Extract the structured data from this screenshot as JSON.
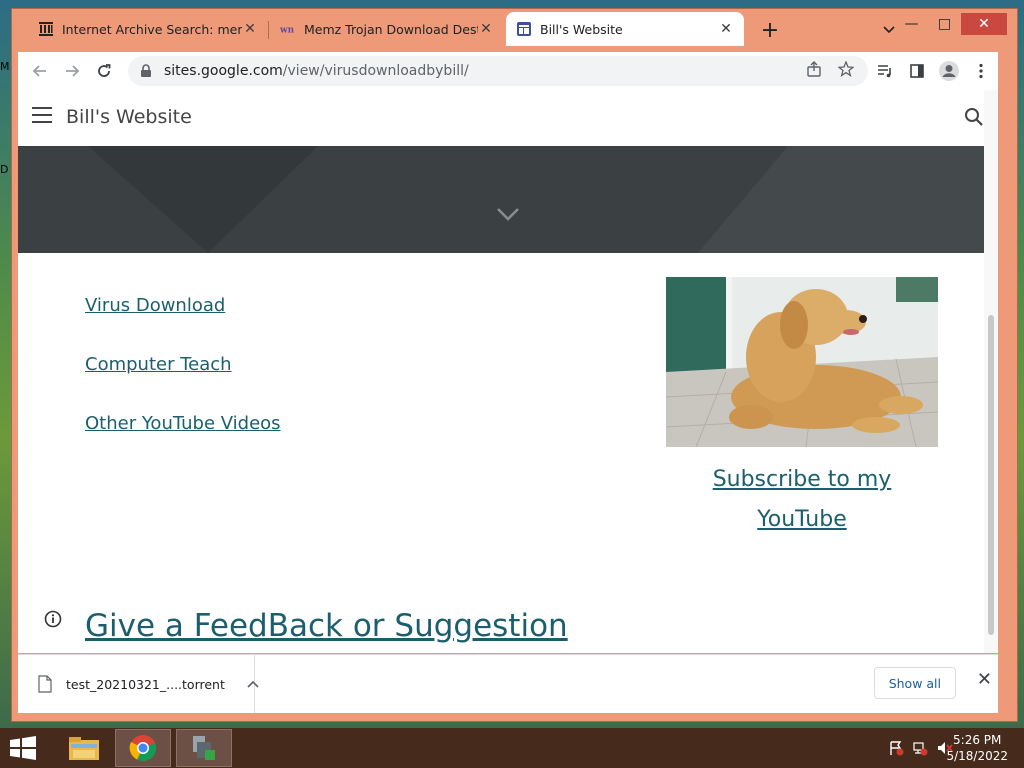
{
  "desktop": {
    "strip_top": "M",
    "strip_mid": "D"
  },
  "tabs": [
    {
      "title": "Internet Archive Search: memz le",
      "icon": "archive-icon"
    },
    {
      "title": "Memz Trojan Download Destruct",
      "icon": "wiki-icon"
    },
    {
      "title": "Bill's Website",
      "icon": "sites-icon"
    }
  ],
  "toolbar": {
    "url_host": "sites.google.com",
    "url_path": "/view/virusdownloadbybill/"
  },
  "site": {
    "title": "Bill's Website",
    "links": [
      "Virus Download",
      "Computer Teach",
      "Other YouTube Videos"
    ],
    "subscribe_line1": "Subscribe to my",
    "subscribe_line2": "YouTube",
    "feedback": "Give a FeedBack or Suggestion"
  },
  "download": {
    "filename": "test_20210321_....torrent",
    "show_all": "Show all"
  },
  "taskbar": {
    "time": "5:26 PM",
    "date": "5/18/2022"
  },
  "colors": {
    "frame": "#ee9a78",
    "link": "#1b5f6e",
    "banner": "#3b4042",
    "taskbar": "#462a1c"
  }
}
